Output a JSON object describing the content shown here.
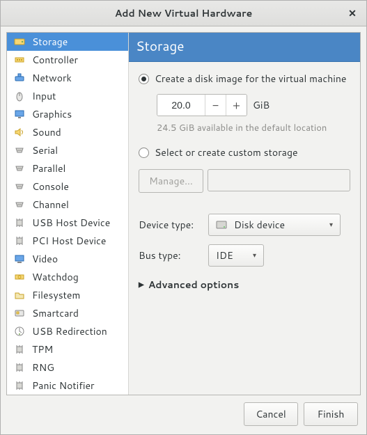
{
  "window": {
    "title": "Add New Virtual Hardware"
  },
  "sidebar": {
    "items": [
      {
        "label": "Storage",
        "selected": true,
        "icon": "storage"
      },
      {
        "label": "Controller",
        "icon": "controller"
      },
      {
        "label": "Network",
        "icon": "network"
      },
      {
        "label": "Input",
        "icon": "input"
      },
      {
        "label": "Graphics",
        "icon": "graphics"
      },
      {
        "label": "Sound",
        "icon": "sound"
      },
      {
        "label": "Serial",
        "icon": "serial"
      },
      {
        "label": "Parallel",
        "icon": "parallel"
      },
      {
        "label": "Console",
        "icon": "console"
      },
      {
        "label": "Channel",
        "icon": "channel"
      },
      {
        "label": "USB Host Device",
        "icon": "usb"
      },
      {
        "label": "PCI Host Device",
        "icon": "pci"
      },
      {
        "label": "Video",
        "icon": "video"
      },
      {
        "label": "Watchdog",
        "icon": "watchdog"
      },
      {
        "label": "Filesystem",
        "icon": "filesystem"
      },
      {
        "label": "Smartcard",
        "icon": "smartcard"
      },
      {
        "label": "USB Redirection",
        "icon": "usbredir"
      },
      {
        "label": "TPM",
        "icon": "tpm"
      },
      {
        "label": "RNG",
        "icon": "rng"
      },
      {
        "label": "Panic Notifier",
        "icon": "panic"
      }
    ]
  },
  "main": {
    "header": "Storage",
    "radio_create_label": "Create a disk image for the virtual machine",
    "radio_custom_label": "Select or create custom storage",
    "size_value": "20.0",
    "size_unit": "GiB",
    "available_hint": "24.5 GiB available in the default location",
    "manage_label": "Manage...",
    "device_type_label": "Device type:",
    "device_type_value": "Disk device",
    "bus_type_label": "Bus type:",
    "bus_type_value": "IDE",
    "advanced_label": "Advanced options"
  },
  "footer": {
    "cancel": "Cancel",
    "finish": "Finish"
  }
}
